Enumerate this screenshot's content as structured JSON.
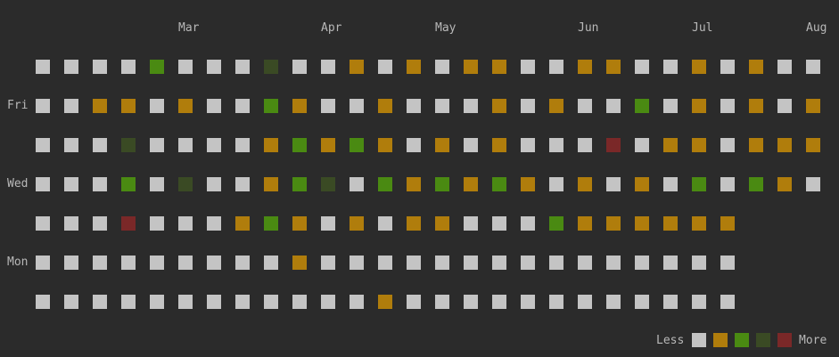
{
  "months": [
    {
      "label": "Mar",
      "col": 5
    },
    {
      "label": "Apr",
      "col": 10
    },
    {
      "label": "May",
      "col": 14
    },
    {
      "label": "Jun",
      "col": 19
    },
    {
      "label": "Jul",
      "col": 23
    },
    {
      "label": "Aug",
      "col": 27
    }
  ],
  "days": [
    {
      "label": "Fri",
      "row": 1
    },
    {
      "label": "Wed",
      "row": 3
    },
    {
      "label": "Mon",
      "row": 5
    }
  ],
  "levels": [
    "#c4c4c4",
    "#b07d0c",
    "#4a8a12",
    "#3a4a24",
    "#7a2828"
  ],
  "grid_rows": [
    "0000200030010101100110010100",
    "0011010021001000101002010101",
    "0003000012121010100040110111",
    "0002030012302121210101020210",
    "0004000121010110002111111",
    "0000000001000000000000000",
    "0000000000001000000000000"
  ],
  "legend": {
    "less": "Less",
    "more": "More"
  }
}
